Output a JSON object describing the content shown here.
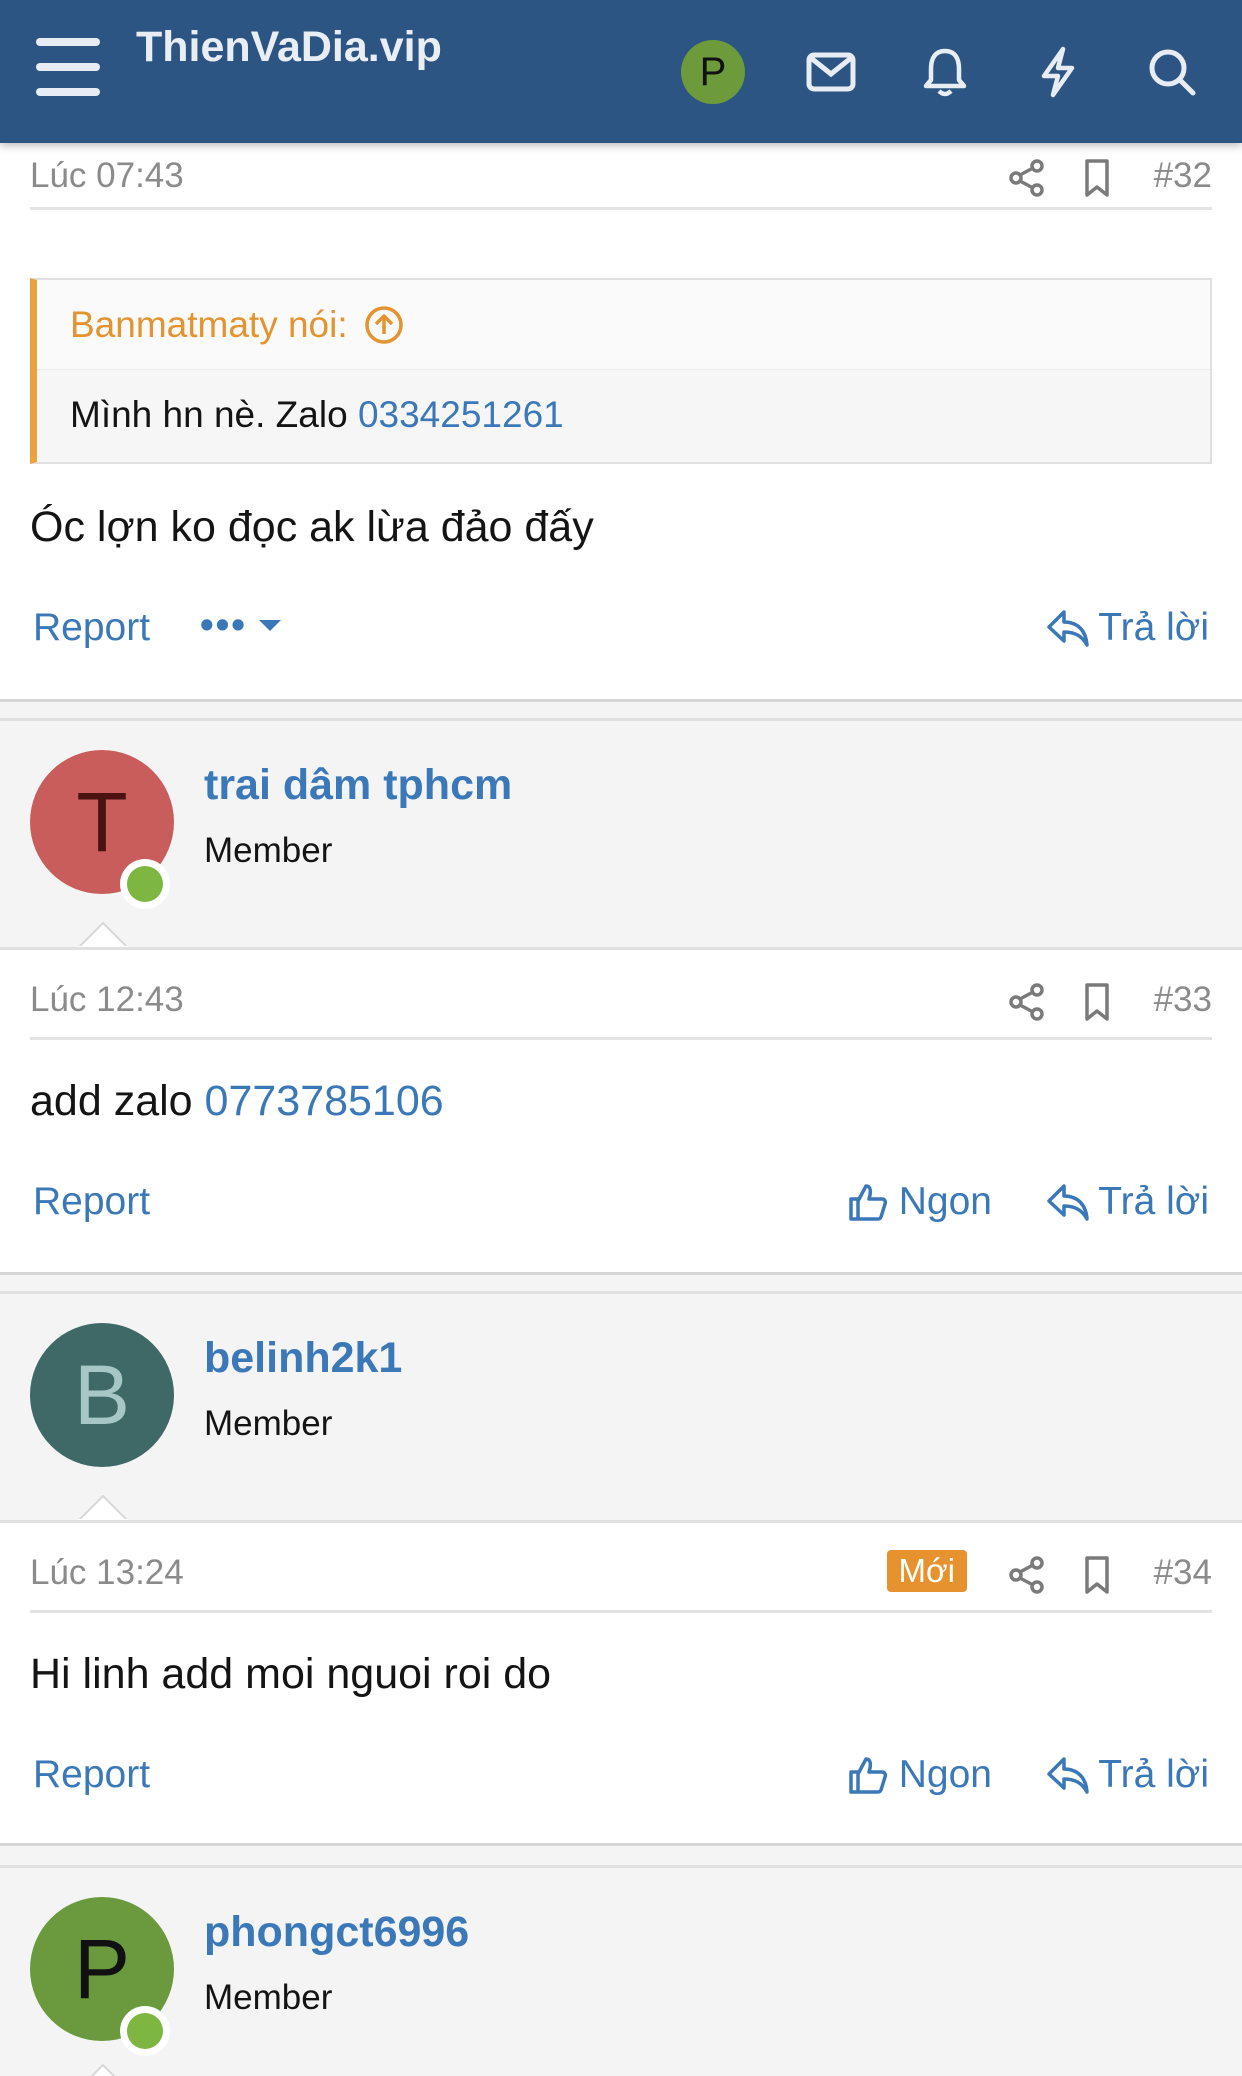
{
  "header": {
    "site_title": "ThienVaDia.vip",
    "user_initial": "P"
  },
  "posts": [
    {
      "time": "Lúc 07:43",
      "number": "#32",
      "quote_author": "Banmatmaty nói:",
      "quote_text": "Mình hn nè. Zalo ",
      "quote_link": "0334251261",
      "message": "Óc lợn ko đọc ak lừa đảo đấy",
      "report": "Report",
      "more": "•••",
      "reply": "Trả lời"
    },
    {
      "author": "trai dâm tphcm",
      "role": "Member",
      "initial": "T",
      "avatar_color": "#c85d5b",
      "initial_color": "#4a1210",
      "time": "Lúc 12:43",
      "number": "#33",
      "message_text": "add zalo ",
      "message_link": "0773785106",
      "report": "Report",
      "like": "Ngon",
      "reply": "Trả lời"
    },
    {
      "author": "belinh2k1",
      "role": "Member",
      "initial": "B",
      "avatar_color": "#3e6967",
      "initial_color": "#a6c7c5",
      "time": "Lúc 13:24",
      "badge": "Mới",
      "number": "#34",
      "message": "Hi linh add moi nguoi roi do",
      "report": "Report",
      "like": "Ngon",
      "reply": "Trả lời"
    },
    {
      "author": "phongct6996",
      "role": "Member",
      "initial": "P",
      "avatar_color": "#6b9a3e",
      "initial_color": "#111111"
    }
  ],
  "colors": {
    "header_bg": "#2c5583",
    "link": "#3a78b8",
    "quote_accent": "#e8a33d",
    "new_badge": "#e5922f",
    "online": "#7db640"
  }
}
